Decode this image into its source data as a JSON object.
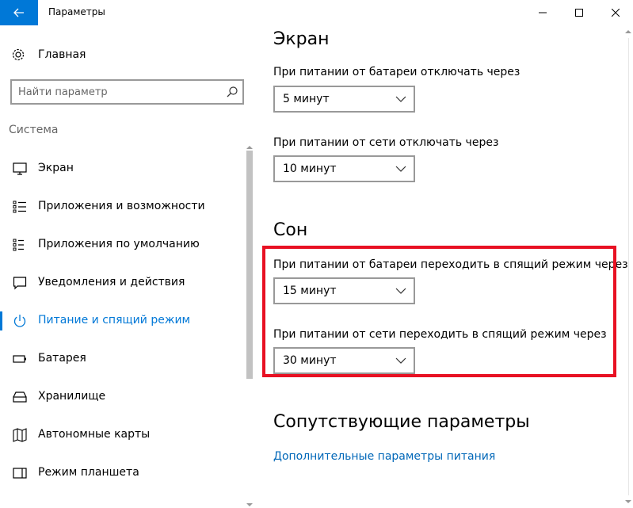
{
  "window": {
    "title": "Параметры"
  },
  "sidebar": {
    "home_label": "Главная",
    "search_placeholder": "Найти параметр",
    "section_label": "Система",
    "items": [
      {
        "label": "Экран",
        "icon": "monitor-icon"
      },
      {
        "label": "Приложения и возможности",
        "icon": "list-icon"
      },
      {
        "label": "Приложения по умолчанию",
        "icon": "default-apps-icon"
      },
      {
        "label": "Уведомления и действия",
        "icon": "notification-icon"
      },
      {
        "label": "Питание и спящий режим",
        "icon": "power-icon",
        "active": true
      },
      {
        "label": "Батарея",
        "icon": "battery-icon"
      },
      {
        "label": "Хранилище",
        "icon": "storage-icon"
      },
      {
        "label": "Автономные карты",
        "icon": "map-icon"
      },
      {
        "label": "Режим планшета",
        "icon": "tablet-icon"
      }
    ]
  },
  "main": {
    "screen_heading": "Экран",
    "screen_battery_label": "При питании от батареи отключать через",
    "screen_battery_value": "5 минут",
    "screen_ac_label": "При питании от сети отключать через",
    "screen_ac_value": "10 минут",
    "sleep_heading": "Сон",
    "sleep_battery_label": "При питании от батареи переходить в спящий режим через",
    "sleep_battery_value": "15 минут",
    "sleep_ac_label": "При питании от сети переходить в спящий режим через",
    "sleep_ac_value": "30 минут",
    "related_heading": "Сопутствующие параметры",
    "related_link": "Дополнительные параметры питания"
  },
  "colors": {
    "accent": "#0078d7",
    "link": "#0067b8",
    "highlight": "#e81123"
  }
}
